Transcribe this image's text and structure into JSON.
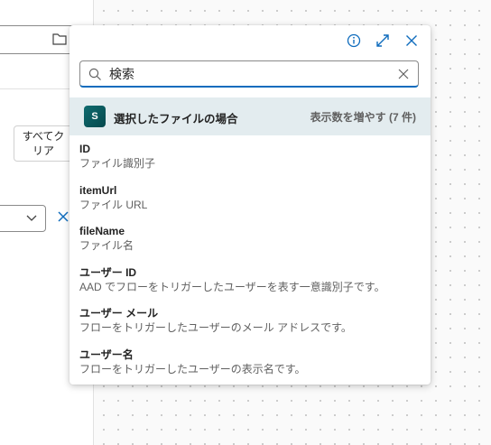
{
  "left_panel": {
    "clear_all_label": "すべてクリア"
  },
  "popover": {
    "search": {
      "placeholder": "検索",
      "value": ""
    },
    "section": {
      "title": "選択したファイルの場合",
      "show_more": "表示数を増やす (7 件)"
    },
    "items": [
      {
        "name": "ID",
        "description": "ファイル識別子"
      },
      {
        "name": "itemUrl",
        "description": "ファイル URL"
      },
      {
        "name": "fileName",
        "description": "ファイル名"
      },
      {
        "name": "ユーザー ID",
        "description": "AAD でフローをトリガーしたユーザーを表す一意識別子です。"
      },
      {
        "name": "ユーザー メール",
        "description": "フローをトリガーしたユーザーのメール アドレスです。"
      },
      {
        "name": "ユーザー名",
        "description": "フローをトリガーしたユーザーの表示名です。"
      }
    ]
  },
  "colors": {
    "accent": "#0f6cbd",
    "section_bg": "#e3ecef",
    "sharepoint": "#0f6b6f"
  },
  "icons": [
    "info-icon",
    "expand-icon",
    "close-icon",
    "search-icon",
    "clear-icon",
    "sharepoint-icon",
    "folder-icon",
    "chevron-down-icon"
  ]
}
